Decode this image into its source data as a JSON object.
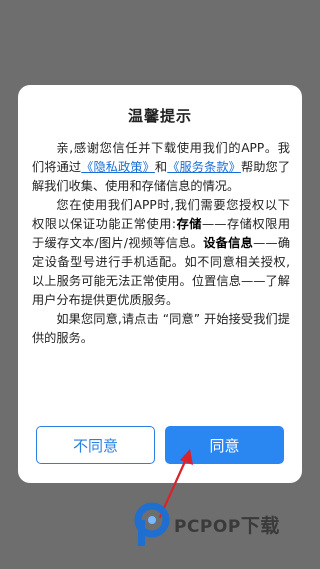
{
  "dialog": {
    "title": "温馨提示",
    "p1_a": "亲,感谢您信任并下载使用我们的APP。我们将通过",
    "privacy_link": "《隐私政策》",
    "p1_b": "和",
    "terms_link": "《服务条款》",
    "p1_c": "帮助您了解我们收集、使用和存储信息的情况。",
    "p2_a": "您在使用我们APP时,我们需要您授权以下权限以保证功能正常使用:",
    "p2_storage": "存储",
    "p2_b": "——存储权限用于缓存文本/图片/视频等信息。",
    "p2_device": "设备信息",
    "p2_c": "——确定设备型号进行手机适配。如不同意相关授权,以上服务可能无法正常使用。位置信息——了解用户分布提供更优质服务。",
    "p3": "如果您同意,请点击 “同意” 开始接受我们提供的服务。",
    "disagree_label": "不同意",
    "agree_label": "同意"
  },
  "watermark": {
    "text_en": "PCPOP",
    "text_cn": "下载"
  },
  "colors": {
    "overlay": "#6e6e6e",
    "accent": "#2a86f0",
    "link": "#1a6fd6",
    "arrow": "#d9232b"
  }
}
